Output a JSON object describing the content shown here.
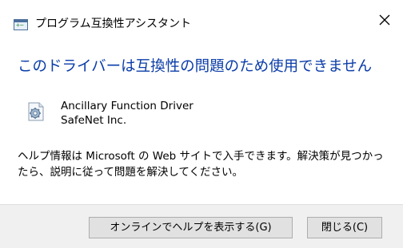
{
  "window": {
    "title": "プログラム互換性アシスタント",
    "close_glyph": "✕"
  },
  "content": {
    "heading": "このドライバーは互換性の問題のため使用できません",
    "driver_name": "Ancillary Function Driver",
    "driver_vendor": "SafeNet Inc.",
    "message": "ヘルプ情報は Microsoft の Web サイトで入手できます。解決策が見つかったら、説明に従って問題を解決してください。"
  },
  "footer": {
    "help_button_label": "オンラインでヘルプを表示する(G)",
    "close_button_label": "閉じる(C)"
  },
  "colors": {
    "heading": "#0a3ca8",
    "footer_bg": "#f0f0f0",
    "button_bg": "#e1e1e1",
    "button_border": "#adadad"
  },
  "icons": {
    "title": "program-compatibility-icon",
    "close": "close-icon",
    "driver": "driver-settings-icon"
  }
}
